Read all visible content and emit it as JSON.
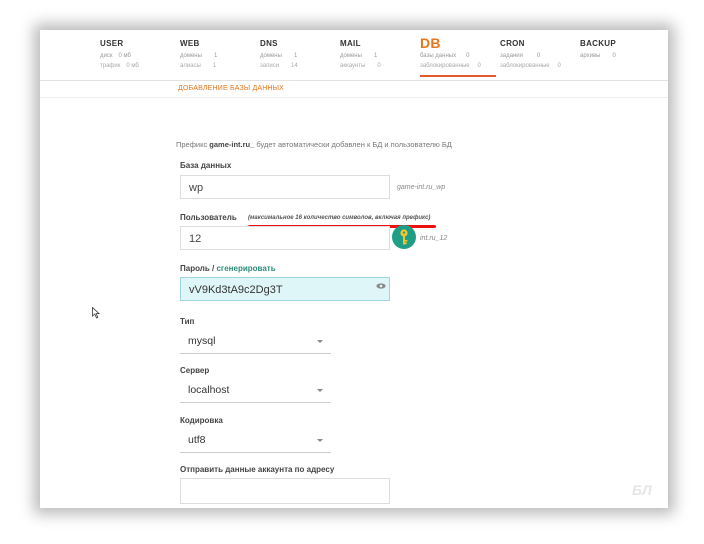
{
  "nav": [
    {
      "title": "USER",
      "row1_label": "диск",
      "row1_value": "0 мб",
      "row2_label": "трафик",
      "row2_value": "0 мб"
    },
    {
      "title": "WEB",
      "row1_label": "домены",
      "row1_value": "1",
      "row2_label": "алиасы",
      "row2_value": "1"
    },
    {
      "title": "DNS",
      "row1_label": "домены",
      "row1_value": "1",
      "row2_label": "записи",
      "row2_value": "14"
    },
    {
      "title": "MAIL",
      "row1_label": "домены",
      "row1_value": "1",
      "row2_label": "аккаунты",
      "row2_value": "0"
    },
    {
      "title": "DB",
      "row1_label": "базы данных",
      "row1_value": "0",
      "row2_label": "заблокированные",
      "row2_value": "0"
    },
    {
      "title": "CRON",
      "row1_label": "задания",
      "row1_value": "0",
      "row2_label": "заблокированные",
      "row2_value": "0"
    },
    {
      "title": "BACKUP",
      "row1_label": "архивы",
      "row1_value": "0",
      "row2_label": "",
      "row2_value": ""
    }
  ],
  "subtab": "ДОБАВЛЕНИЕ БАЗЫ ДАННЫХ",
  "prefix_pre": "Префикс ",
  "prefix_bold": "game-int.ru_",
  "prefix_post": " будет автоматически добавлен к БД и пользователю БД",
  "db": {
    "label": "База данных",
    "value": "wp",
    "suffix": "game-int.ru_wp"
  },
  "user": {
    "label": "Пользователь",
    "hint": "(максимальное 16 количество символов, включая префикс)",
    "value": "12",
    "suffix": "int.ru_12"
  },
  "password": {
    "label": "Пароль",
    "separator": " / ",
    "generate": "сгенерировать",
    "value": "vV9Kd3tA9c2Dg3T"
  },
  "type": {
    "label": "Тип",
    "value": "mysql"
  },
  "server": {
    "label": "Сервер",
    "value": "localhost"
  },
  "charset": {
    "label": "Кодировка",
    "value": "utf8"
  },
  "email": {
    "label": "Отправить данные аккаунта по адресу",
    "value": ""
  },
  "colors": {
    "accent": "#e9761b",
    "link": "#2a8c7a",
    "password_bg": "#dff6f8",
    "annotation_red": "#e11111"
  }
}
